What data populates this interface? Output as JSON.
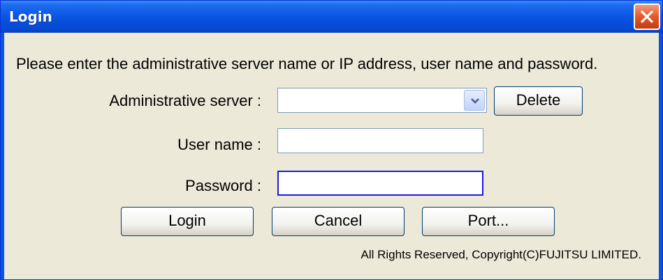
{
  "window": {
    "title": "Login"
  },
  "instruction": "Please enter the administrative server name or IP address, user name and password.",
  "fields": {
    "server_label": "Administrative server :",
    "server_value": "",
    "user_label": "User name :",
    "user_value": "",
    "password_label": "Password  :",
    "password_value": ""
  },
  "buttons": {
    "delete": "Delete",
    "login": "Login",
    "cancel": "Cancel",
    "port": "Port..."
  },
  "copyright": "All Rights Reserved, Copyright(C)FUJITSU LIMITED.",
  "icons": {
    "close": "close-icon",
    "dropdown": "chevron-down-icon"
  },
  "colors": {
    "titlebar": "#0a55e2",
    "close": "#e3592b",
    "dialog_bg": "#ece9d8",
    "focus_border": "#1a1ae0"
  }
}
